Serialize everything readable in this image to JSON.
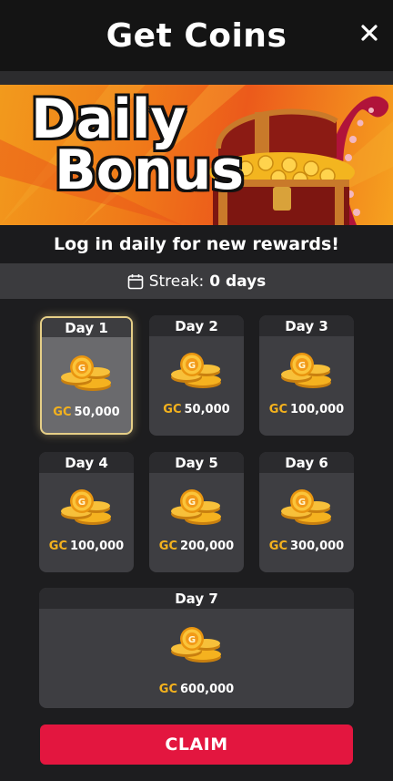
{
  "header": {
    "title": "Get Coins",
    "close_icon": "close-icon"
  },
  "banner": {
    "line1": "Daily",
    "line2": "Bonus",
    "image": "treasure-chest-with-tentacle"
  },
  "subtitle": "Log in daily for new rewards!",
  "streak": {
    "icon": "calendar-icon",
    "label": "Streak:",
    "value": "0 days"
  },
  "days": [
    {
      "label": "Day 1",
      "currency": "GC",
      "amount": "50,000",
      "active": true
    },
    {
      "label": "Day 2",
      "currency": "GC",
      "amount": "50,000",
      "active": false
    },
    {
      "label": "Day 3",
      "currency": "GC",
      "amount": "100,000",
      "active": false
    },
    {
      "label": "Day 4",
      "currency": "GC",
      "amount": "100,000",
      "active": false
    },
    {
      "label": "Day 5",
      "currency": "GC",
      "amount": "200,000",
      "active": false
    },
    {
      "label": "Day 6",
      "currency": "GC",
      "amount": "300,000",
      "active": false
    },
    {
      "label": "Day 7",
      "currency": "GC",
      "amount": "600,000",
      "active": false
    }
  ],
  "claim_label": "CLAIM",
  "colors": {
    "claim": "#e3163f",
    "gc": "#f4b21d",
    "active_border": "#e6cf87"
  }
}
